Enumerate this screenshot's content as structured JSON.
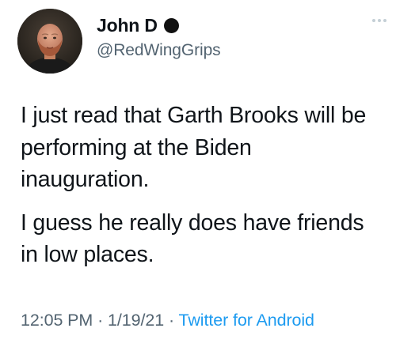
{
  "author": {
    "display_name": "John D",
    "handle": "@RedWingGrips",
    "avatar": "profile-photo"
  },
  "tweet": {
    "paragraphs": [
      "I just read that Garth Brooks will be performing at the Biden inauguration.",
      "I guess he really does have friends in low places."
    ]
  },
  "meta": {
    "time": "12:05 PM",
    "separator": "·",
    "date": "1/19/21",
    "source": "Twitter for Android"
  },
  "icons": {
    "more": "more-options-icon",
    "name_dot": "filled-circle"
  },
  "colors": {
    "text": "#0f1419",
    "secondary": "#536471",
    "link": "#1d9bf0"
  }
}
